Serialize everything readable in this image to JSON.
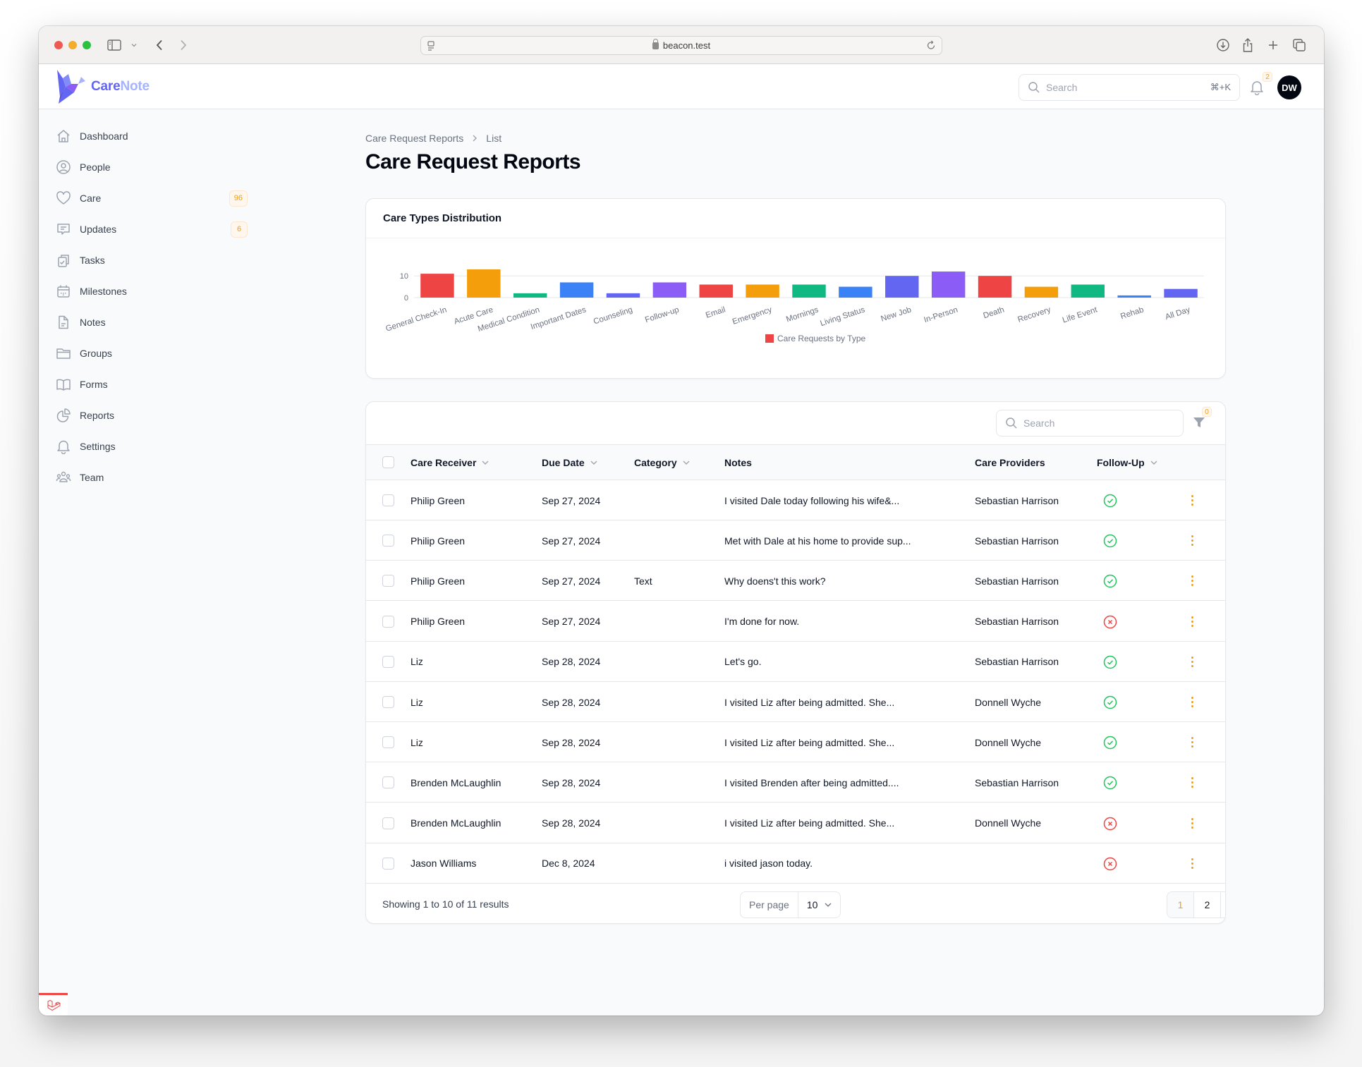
{
  "browser": {
    "url": "beacon.test"
  },
  "app": {
    "logo_part1": "Care",
    "logo_part2": "Note",
    "search_placeholder": "Search",
    "search_shortcut": "⌘+K",
    "notification_count": "2",
    "user_initials": "DW"
  },
  "sidebar": {
    "items": [
      {
        "label": "Dashboard",
        "icon": "home-icon"
      },
      {
        "label": "People",
        "icon": "user-circle-icon"
      },
      {
        "label": "Care",
        "icon": "heart-icon",
        "badge": "96"
      },
      {
        "label": "Updates",
        "icon": "chat-icon",
        "badge": "6"
      },
      {
        "label": "Tasks",
        "icon": "clipboard-check-icon"
      },
      {
        "label": "Milestones",
        "icon": "calendar-icon"
      },
      {
        "label": "Notes",
        "icon": "document-icon"
      },
      {
        "label": "Groups",
        "icon": "folder-icon"
      },
      {
        "label": "Forms",
        "icon": "book-open-icon"
      },
      {
        "label": "Reports",
        "icon": "chart-pie-icon"
      },
      {
        "label": "Settings",
        "icon": "bell-icon"
      },
      {
        "label": "Team",
        "icon": "user-group-icon"
      }
    ]
  },
  "breadcrumb": {
    "parent": "Care Request Reports",
    "current": "List"
  },
  "page_title": "Care Request Reports",
  "chart_card": {
    "title": "Care Types Distribution"
  },
  "chart_data": {
    "type": "bar",
    "title": "Care Types Distribution",
    "xlabel": "",
    "ylabel": "",
    "ylim": [
      0,
      13
    ],
    "yticks": [
      0,
      10
    ],
    "grid": true,
    "legend_position": "bottom",
    "categories": [
      "General Check-In",
      "Acute Care",
      "Medical Condition",
      "Important Dates",
      "Counseling",
      "Follow-up",
      "Email",
      "Emergency",
      "Mornings",
      "Living Status",
      "New Job",
      "In-Person",
      "Death",
      "Recovery",
      "Life Event",
      "Rehab",
      "All Day"
    ],
    "series": [
      {
        "name": "Care Requests by Type",
        "values": [
          11,
          13,
          2,
          7,
          2,
          7,
          6,
          6,
          6,
          5,
          10,
          12,
          10,
          5,
          6,
          1,
          4
        ]
      }
    ],
    "colors": [
      "#ef4444",
      "#f59e0b",
      "#10b981",
      "#3b82f6",
      "#6366f1",
      "#8b5cf6",
      "#ef4444",
      "#f59e0b",
      "#10b981",
      "#3b82f6",
      "#6366f1",
      "#8b5cf6",
      "#ef4444",
      "#f59e0b",
      "#10b981",
      "#3b82f6",
      "#6366f1"
    ]
  },
  "table": {
    "search_placeholder": "Search",
    "filter_count": "0",
    "columns": {
      "care_receiver": "Care Receiver",
      "due_date": "Due Date",
      "category": "Category",
      "notes": "Notes",
      "care_providers": "Care Providers",
      "follow_up": "Follow-Up"
    },
    "rows": [
      {
        "receiver": "Philip Green",
        "due": "Sep 27, 2024",
        "category": "",
        "notes": "I visited Dale today following his wife&...",
        "provider": "Sebastian Harrison",
        "follow_up": true
      },
      {
        "receiver": "Philip Green",
        "due": "Sep 27, 2024",
        "category": "",
        "notes": "Met with Dale at his home to provide sup...",
        "provider": "Sebastian Harrison",
        "follow_up": true
      },
      {
        "receiver": "Philip Green",
        "due": "Sep 27, 2024",
        "category": "Text",
        "notes": "Why doens't this work?",
        "provider": "Sebastian Harrison",
        "follow_up": true
      },
      {
        "receiver": "Philip Green",
        "due": "Sep 27, 2024",
        "category": "",
        "notes": "I'm done for now.",
        "provider": "Sebastian Harrison",
        "follow_up": false
      },
      {
        "receiver": "Liz",
        "due": "Sep 28, 2024",
        "category": "",
        "notes": "Let's go.",
        "provider": "Sebastian Harrison",
        "follow_up": true
      },
      {
        "receiver": "Liz",
        "due": "Sep 28, 2024",
        "category": "",
        "notes": "I visited Liz after being admitted. She...",
        "provider": "Donnell Wyche",
        "follow_up": true
      },
      {
        "receiver": "Liz",
        "due": "Sep 28, 2024",
        "category": "",
        "notes": "I visited Liz after being admitted. She...",
        "provider": "Donnell Wyche",
        "follow_up": true
      },
      {
        "receiver": "Brenden McLaughlin",
        "due": "Sep 28, 2024",
        "category": "",
        "notes": "I visited Brenden after being admitted....",
        "provider": "Sebastian Harrison",
        "follow_up": true
      },
      {
        "receiver": "Brenden McLaughlin",
        "due": "Sep 28, 2024",
        "category": "",
        "notes": "I visited Liz after being admitted. She...",
        "provider": "Donnell Wyche",
        "follow_up": false
      },
      {
        "receiver": "Jason Williams",
        "due": "Dec 8, 2024",
        "category": "",
        "notes": "i visited jason today.",
        "provider": "",
        "follow_up": false
      }
    ],
    "footer": {
      "showing": "Showing 1 to 10 of 11 results",
      "per_page_label": "Per page",
      "per_page_value": "10",
      "pages": [
        "1",
        "2"
      ],
      "current_page": "1"
    }
  },
  "colors": {
    "accent": "#f59e0b",
    "brand": "#6366f1",
    "success": "#22c55e",
    "danger": "#ef4444"
  }
}
